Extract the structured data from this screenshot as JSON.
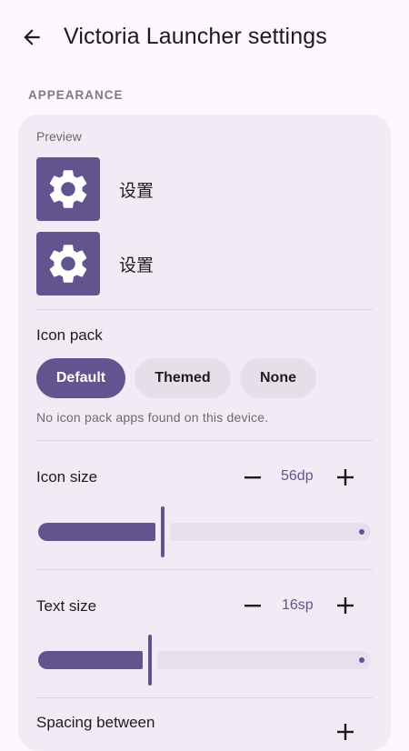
{
  "header": {
    "title": "Victoria Launcher settings",
    "back_icon": "arrow-back-icon"
  },
  "appearance": {
    "section_label": "APPEARANCE",
    "preview": {
      "label": "Preview",
      "apps": [
        {
          "label": "设置",
          "icon": "gear-icon"
        },
        {
          "label": "设置",
          "icon": "gear-icon"
        }
      ]
    },
    "icon_pack": {
      "label": "Icon pack",
      "options": [
        "Default",
        "Themed",
        "None"
      ],
      "selected": "Default",
      "note": "No icon pack apps found on this device."
    },
    "icon_size": {
      "label": "Icon size",
      "value": "56dp",
      "fraction": 0.37
    },
    "text_size": {
      "label": "Text size",
      "value": "16sp",
      "fraction": 0.33
    },
    "spacing": {
      "label": "Spacing between"
    }
  },
  "colors": {
    "accent": "#635490",
    "card": "#f1ebf5",
    "background": "#fdf7fe"
  }
}
